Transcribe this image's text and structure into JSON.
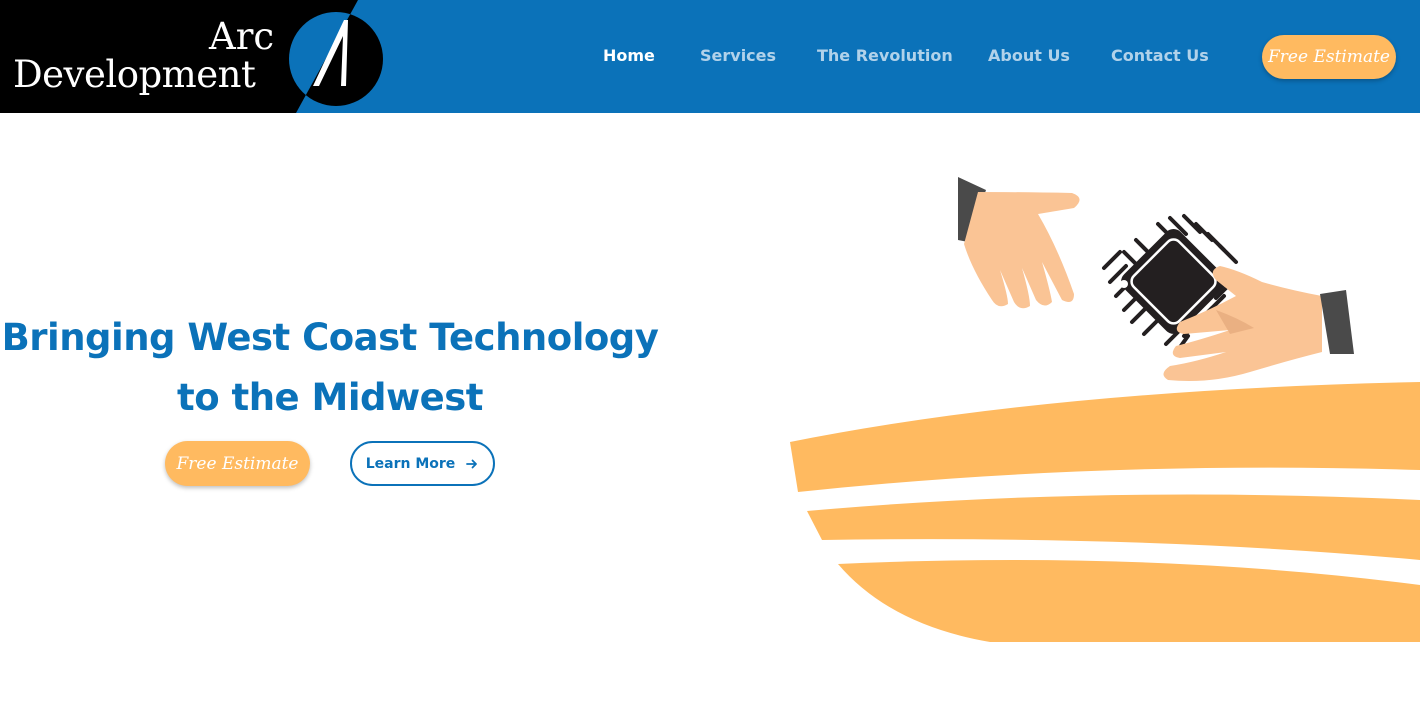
{
  "header": {
    "logo": {
      "line1": "Arc",
      "line2": "Development"
    },
    "nav": [
      {
        "label": "Home",
        "active": true
      },
      {
        "label": "Services",
        "active": false
      },
      {
        "label": "The Revolution",
        "active": false
      },
      {
        "label": "About Us",
        "active": false
      },
      {
        "label": "Contact Us",
        "active": false
      }
    ],
    "cta_label": "Free Estimate"
  },
  "hero": {
    "title_line1": "Bringing West Coast Technology",
    "title_line2": "to the Midwest",
    "estimate_label": "Free Estimate",
    "learn_more_label": "Learn More",
    "illustration_icon": "hands-exchanging-chip-illustration"
  },
  "colors": {
    "primary_blue": "#0b72b9",
    "accent_orange": "#ffba60",
    "black": "#000000",
    "white": "#ffffff"
  }
}
